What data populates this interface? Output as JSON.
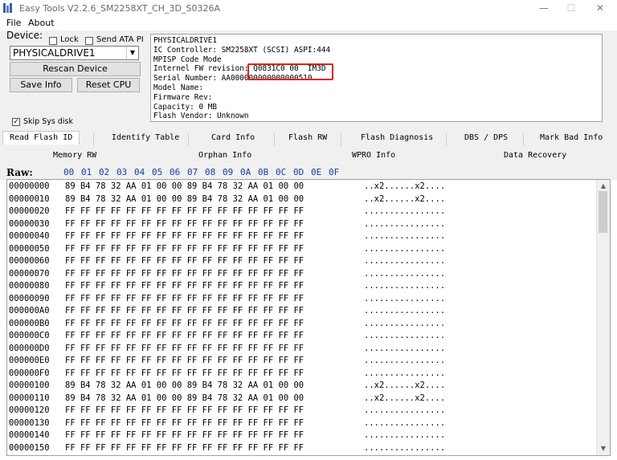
{
  "window": {
    "title": "Easy Tools V2.2.6_SM2258XT_CH_3D_S0326A",
    "minimize": "—",
    "maximize": "☐",
    "close": "✕"
  },
  "menu": [
    "File",
    "About"
  ],
  "device": {
    "group_label": "Device:",
    "lock_label": "Lock",
    "send_ata_label": "Send ATA PI",
    "selected": "PHYSICALDRIVE1",
    "rescan": "Rescan Device",
    "save_info": "Save Info",
    "reset_cpu": "Reset CPU",
    "skip_sys_disk": "Skip Sys disk",
    "skip_sys_checked": true
  },
  "info_lines": [
    "PHYSICALDRIVE1",
    "IC Controller: SM2258XT (SCSI) ASPI:444",
    "MPISP Code Mode",
    "Internel FW revision: Q0831C0 00  IM3D",
    "Serial Number: AA000000000000000510",
    "Model Name:",
    "Firmware Rev:",
    "Capacity: 0 MB",
    "Flash Vendor: Unknown"
  ],
  "tabs_row1": [
    "Read Flash ID",
    "Identify Table",
    "Card Info",
    "Flash RW",
    "Flash Diagnosis",
    "DBS / DPS",
    "Mark Bad Info"
  ],
  "tabs_row2": [
    "Memory RW",
    "Orphan Info",
    "WPRO Info",
    "Data Recovery"
  ],
  "raw": {
    "label": "Raw:",
    "columns": [
      "00",
      "01",
      "02",
      "03",
      "04",
      "05",
      "06",
      "07",
      "08",
      "09",
      "0A",
      "0B",
      "0C",
      "0D",
      "0E",
      "0F"
    ]
  },
  "hex_rows": [
    {
      "addr": "00000000",
      "bytes": "89 B4 78 32 AA 01 00 00 89 B4 78 32 AA 01 00 00",
      "ascii": "..x2......x2...."
    },
    {
      "addr": "00000010",
      "bytes": "89 B4 78 32 AA 01 00 00 89 B4 78 32 AA 01 00 00",
      "ascii": "..x2......x2...."
    },
    {
      "addr": "00000020",
      "bytes": "FF FF FF FF FF FF FF FF FF FF FF FF FF FF FF FF",
      "ascii": "................"
    },
    {
      "addr": "00000030",
      "bytes": "FF FF FF FF FF FF FF FF FF FF FF FF FF FF FF FF",
      "ascii": "................"
    },
    {
      "addr": "00000040",
      "bytes": "FF FF FF FF FF FF FF FF FF FF FF FF FF FF FF FF",
      "ascii": "................"
    },
    {
      "addr": "00000050",
      "bytes": "FF FF FF FF FF FF FF FF FF FF FF FF FF FF FF FF",
      "ascii": "................"
    },
    {
      "addr": "00000060",
      "bytes": "FF FF FF FF FF FF FF FF FF FF FF FF FF FF FF FF",
      "ascii": "................"
    },
    {
      "addr": "00000070",
      "bytes": "FF FF FF FF FF FF FF FF FF FF FF FF FF FF FF FF",
      "ascii": "................"
    },
    {
      "addr": "00000080",
      "bytes": "FF FF FF FF FF FF FF FF FF FF FF FF FF FF FF FF",
      "ascii": "................"
    },
    {
      "addr": "00000090",
      "bytes": "FF FF FF FF FF FF FF FF FF FF FF FF FF FF FF FF",
      "ascii": "................"
    },
    {
      "addr": "000000A0",
      "bytes": "FF FF FF FF FF FF FF FF FF FF FF FF FF FF FF FF",
      "ascii": "................"
    },
    {
      "addr": "000000B0",
      "bytes": "FF FF FF FF FF FF FF FF FF FF FF FF FF FF FF FF",
      "ascii": "................"
    },
    {
      "addr": "000000C0",
      "bytes": "FF FF FF FF FF FF FF FF FF FF FF FF FF FF FF FF",
      "ascii": "................"
    },
    {
      "addr": "000000D0",
      "bytes": "FF FF FF FF FF FF FF FF FF FF FF FF FF FF FF FF",
      "ascii": "................"
    },
    {
      "addr": "000000E0",
      "bytes": "FF FF FF FF FF FF FF FF FF FF FF FF FF FF FF FF",
      "ascii": "................"
    },
    {
      "addr": "000000F0",
      "bytes": "FF FF FF FF FF FF FF FF FF FF FF FF FF FF FF FF",
      "ascii": "................"
    },
    {
      "addr": "00000100",
      "bytes": "89 B4 78 32 AA 01 00 00 89 B4 78 32 AA 01 00 00",
      "ascii": "..x2......x2...."
    },
    {
      "addr": "00000110",
      "bytes": "89 B4 78 32 AA 01 00 00 89 B4 78 32 AA 01 00 00",
      "ascii": "..x2......x2...."
    },
    {
      "addr": "00000120",
      "bytes": "FF FF FF FF FF FF FF FF FF FF FF FF FF FF FF FF",
      "ascii": "................"
    },
    {
      "addr": "00000130",
      "bytes": "FF FF FF FF FF FF FF FF FF FF FF FF FF FF FF FF",
      "ascii": "................"
    },
    {
      "addr": "00000140",
      "bytes": "FF FF FF FF FF FF FF FF FF FF FF FF FF FF FF FF",
      "ascii": "................"
    },
    {
      "addr": "00000150",
      "bytes": "FF FF FF FF FF FF FF FF FF FF FF FF FF FF FF FF",
      "ascii": "................"
    }
  ],
  "colors": {
    "highlight": "#e0211b",
    "column_header": "#1a38a8"
  }
}
